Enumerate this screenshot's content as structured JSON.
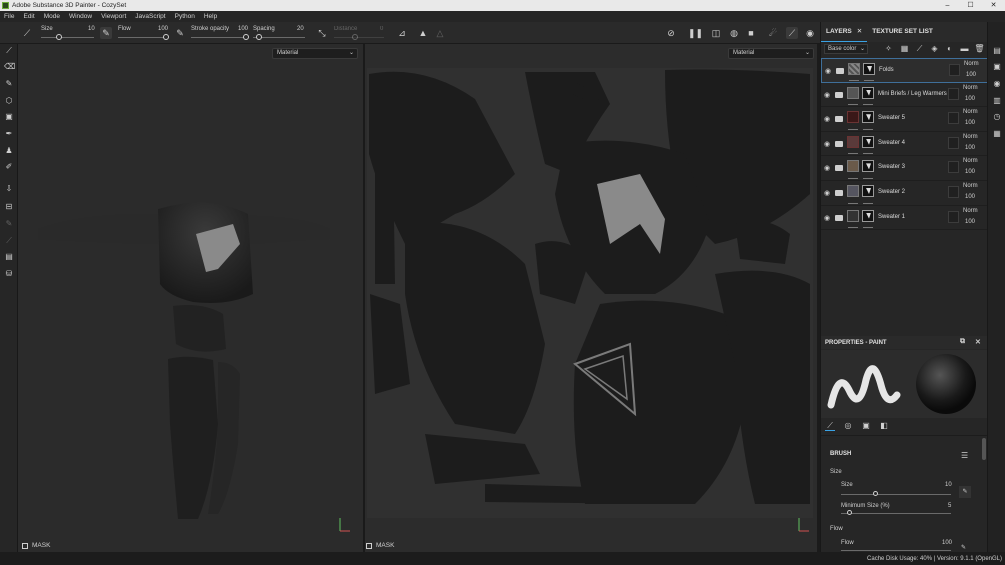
{
  "window": {
    "title": "Adobe Substance 3D Painter - CozySet",
    "minimize": "–",
    "maximize": "☐",
    "close": "✕"
  },
  "menu": [
    "File",
    "Edit",
    "Mode",
    "Window",
    "Viewport",
    "JavaScript",
    "Python",
    "Help"
  ],
  "toolbar": {
    "size_label": "Size",
    "size_value": "10",
    "flow_label": "Flow",
    "flow_value": "100",
    "stroke_opacity_label": "Stroke opacity",
    "stroke_opacity_value": "100",
    "spacing_label": "Spacing",
    "spacing_value": "20",
    "distance_label": "Distance",
    "distance_value": "0"
  },
  "viewport3d": {
    "mode": "Material",
    "mask_label": "MASK"
  },
  "viewport2d": {
    "mode": "Material",
    "mask_label": "MASK"
  },
  "layers_panel": {
    "tab_layers": "LAYERS",
    "tab_texture_set": "TEXTURE SET LIST",
    "channel": "Base color",
    "layers": [
      {
        "name": "Folds",
        "blend": "Norm",
        "opacity": "100",
        "selected": true
      },
      {
        "name": "Mini Briefs / Leg Warmers",
        "blend": "Norm",
        "opacity": "100",
        "selected": false
      },
      {
        "name": "Sweater 5",
        "blend": "Norm",
        "opacity": "100",
        "selected": false
      },
      {
        "name": "Sweater 4",
        "blend": "Norm",
        "opacity": "100",
        "selected": false
      },
      {
        "name": "Sweater 3",
        "blend": "Norm",
        "opacity": "100",
        "selected": false
      },
      {
        "name": "Sweater 2",
        "blend": "Norm",
        "opacity": "100",
        "selected": false
      },
      {
        "name": "Sweater 1",
        "blend": "Norm",
        "opacity": "100",
        "selected": false
      }
    ]
  },
  "properties": {
    "title": "PROPERTIES - PAINT",
    "brush_heading": "BRUSH",
    "size_section": "Size",
    "size_label": "Size",
    "size_value": "10",
    "min_size_label": "Minimum Size (%)",
    "min_size_value": "5",
    "flow_section": "Flow",
    "flow_label": "Flow",
    "flow_value": "100"
  },
  "status": {
    "text": "Cache Disk Usage:   40%  |  Version: 9.1.1 (OpenGL)"
  },
  "colors": {
    "accent": "#3aa2e4",
    "panel": "#262626",
    "viewport": "#2c2c2c"
  }
}
